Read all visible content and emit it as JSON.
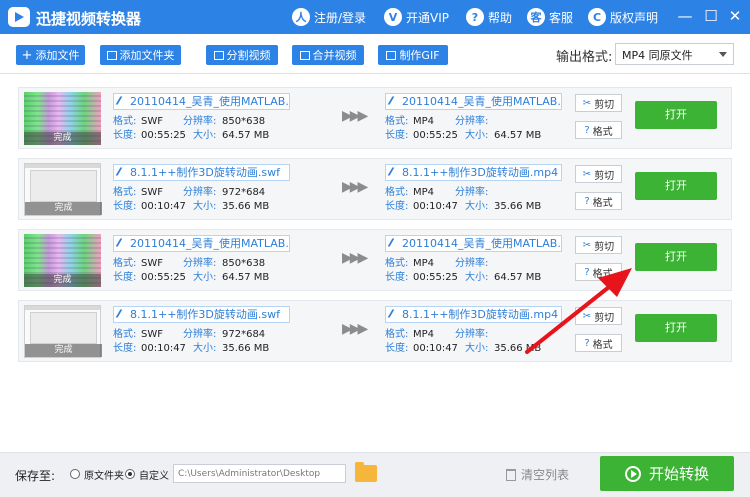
{
  "app": {
    "title": "迅捷视频转换器"
  },
  "titlebar": {
    "items": [
      {
        "icon": "user-icon",
        "glyph": "人",
        "label": "注册/登录"
      },
      {
        "icon": "vip-icon",
        "glyph": "V",
        "label": "开通VIP"
      },
      {
        "icon": "help-icon",
        "glyph": "?",
        "label": "帮助"
      },
      {
        "icon": "headset-icon",
        "glyph": "客",
        "label": "客服"
      },
      {
        "icon": "copyright-icon",
        "glyph": "C",
        "label": "版权声明"
      }
    ]
  },
  "toolbar": {
    "add_file": "添加文件",
    "add_folder": "添加文件夹",
    "split_video": "分割视频",
    "merge_video": "合并视频",
    "make_gif": "制作GIF",
    "output_format_label": "输出格式:",
    "output_format_value": "MP4  同原文件"
  },
  "labels": {
    "format": "格式:",
    "duration": "长度:",
    "resolution": "分辨率:",
    "size": "大小:",
    "done": "完成",
    "cut": "剪切",
    "fmt": "格式",
    "open": "打开"
  },
  "rows": [
    {
      "thumb": "green",
      "src_name": "20110414_吴青_使用MATLAB...",
      "src_format": "SWF",
      "src_duration": "00:55:25",
      "src_resolution": "850*638",
      "src_size": "64.57 MB",
      "dst_name": "20110414_吴青_使用MATLAB...",
      "dst_format": "MP4",
      "dst_duration": "00:55:25",
      "dst_resolution": "",
      "dst_size": "64.57 MB"
    },
    {
      "thumb": "screen",
      "src_name": "8.1.1++制作3D旋转动画.swf",
      "src_format": "SWF",
      "src_duration": "00:10:47",
      "src_resolution": "972*684",
      "src_size": "35.66 MB",
      "dst_name": "8.1.1++制作3D旋转动画.mp4",
      "dst_format": "MP4",
      "dst_duration": "00:10:47",
      "dst_resolution": "",
      "dst_size": "35.66 MB"
    },
    {
      "thumb": "green",
      "src_name": "20110414_吴青_使用MATLAB...",
      "src_format": "SWF",
      "src_duration": "00:55:25",
      "src_resolution": "850*638",
      "src_size": "64.57 MB",
      "dst_name": "20110414_吴青_使用MATLAB...",
      "dst_format": "MP4",
      "dst_duration": "00:55:25",
      "dst_resolution": "",
      "dst_size": "64.57 MB"
    },
    {
      "thumb": "screen",
      "src_name": "8.1.1++制作3D旋转动画.swf",
      "src_format": "SWF",
      "src_duration": "00:10:47",
      "src_resolution": "972*684",
      "src_size": "35.66 MB",
      "dst_name": "8.1.1++制作3D旋转动画.mp4",
      "dst_format": "MP4",
      "dst_duration": "00:10:47",
      "dst_resolution": "",
      "dst_size": "35.66 MB"
    }
  ],
  "bottom": {
    "save_to": "保存至:",
    "option_original": "原文件夹",
    "option_custom": "自定义",
    "selected_option": "custom",
    "path": "C:\\Users\\Administrator\\Desktop",
    "clear_list": "清空列表",
    "start": "开始转换"
  },
  "colors": {
    "primary": "#2d82e6",
    "green": "#3cb335",
    "annotation_arrow": "#e8141b"
  }
}
